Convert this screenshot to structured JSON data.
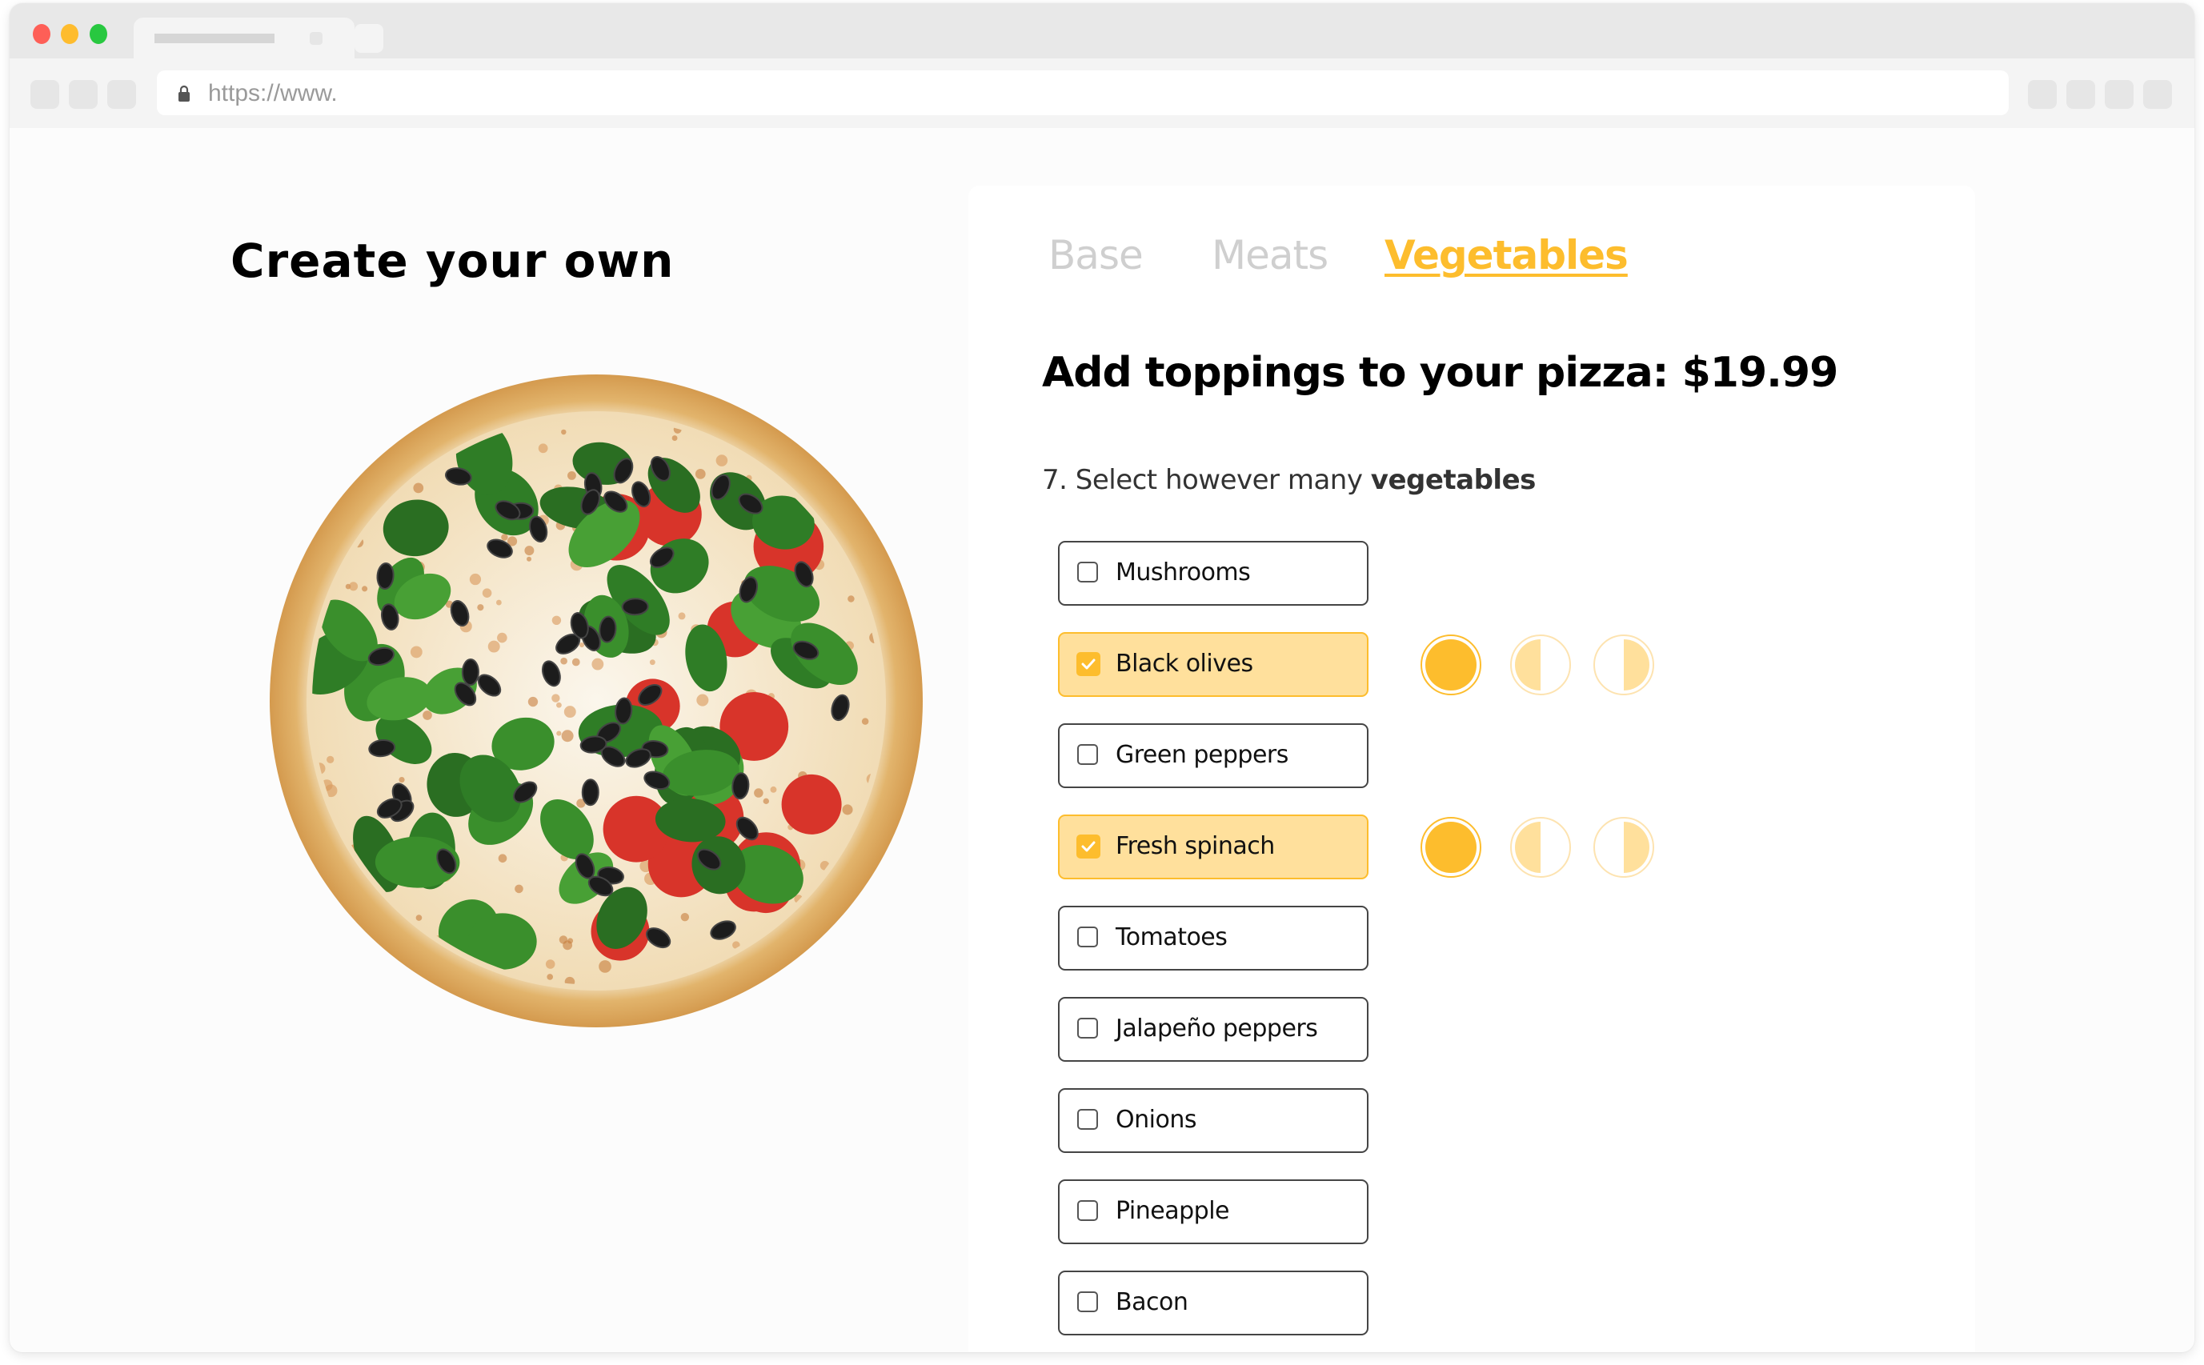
{
  "browser": {
    "url": "https://www.",
    "tab_title": ""
  },
  "left": {
    "title": "Create your own",
    "pizza_image_alt": "pizza with spinach, black olives and pepperoni"
  },
  "steps": {
    "tabs": [
      {
        "label": "Base",
        "active": false
      },
      {
        "label": "Meats",
        "active": false
      },
      {
        "label": "Vegetables",
        "active": true
      }
    ]
  },
  "main": {
    "heading": "Add toppings to your pizza: $19.99",
    "instruction_prefix": "7. Select however many ",
    "instruction_bold": "vegetables"
  },
  "toppings": [
    {
      "label": "Mushrooms",
      "checked": false
    },
    {
      "label": "Black olives",
      "checked": true,
      "portion": "whole"
    },
    {
      "label": "Green peppers",
      "checked": false
    },
    {
      "label": "Fresh spinach",
      "checked": true,
      "portion": "whole"
    },
    {
      "label": "Tomatoes",
      "checked": false
    },
    {
      "label": "Jalapeño peppers",
      "checked": false
    },
    {
      "label": "Onions",
      "checked": false
    },
    {
      "label": "Pineapple",
      "checked": false
    },
    {
      "label": "Bacon",
      "checked": false
    }
  ],
  "portion_options": [
    "whole",
    "left-half",
    "right-half"
  ],
  "colors": {
    "accent": "#fdbd2d",
    "accent_light": "#ffe09c",
    "inactive_tab": "#cfcfcf",
    "border": "#454545"
  }
}
